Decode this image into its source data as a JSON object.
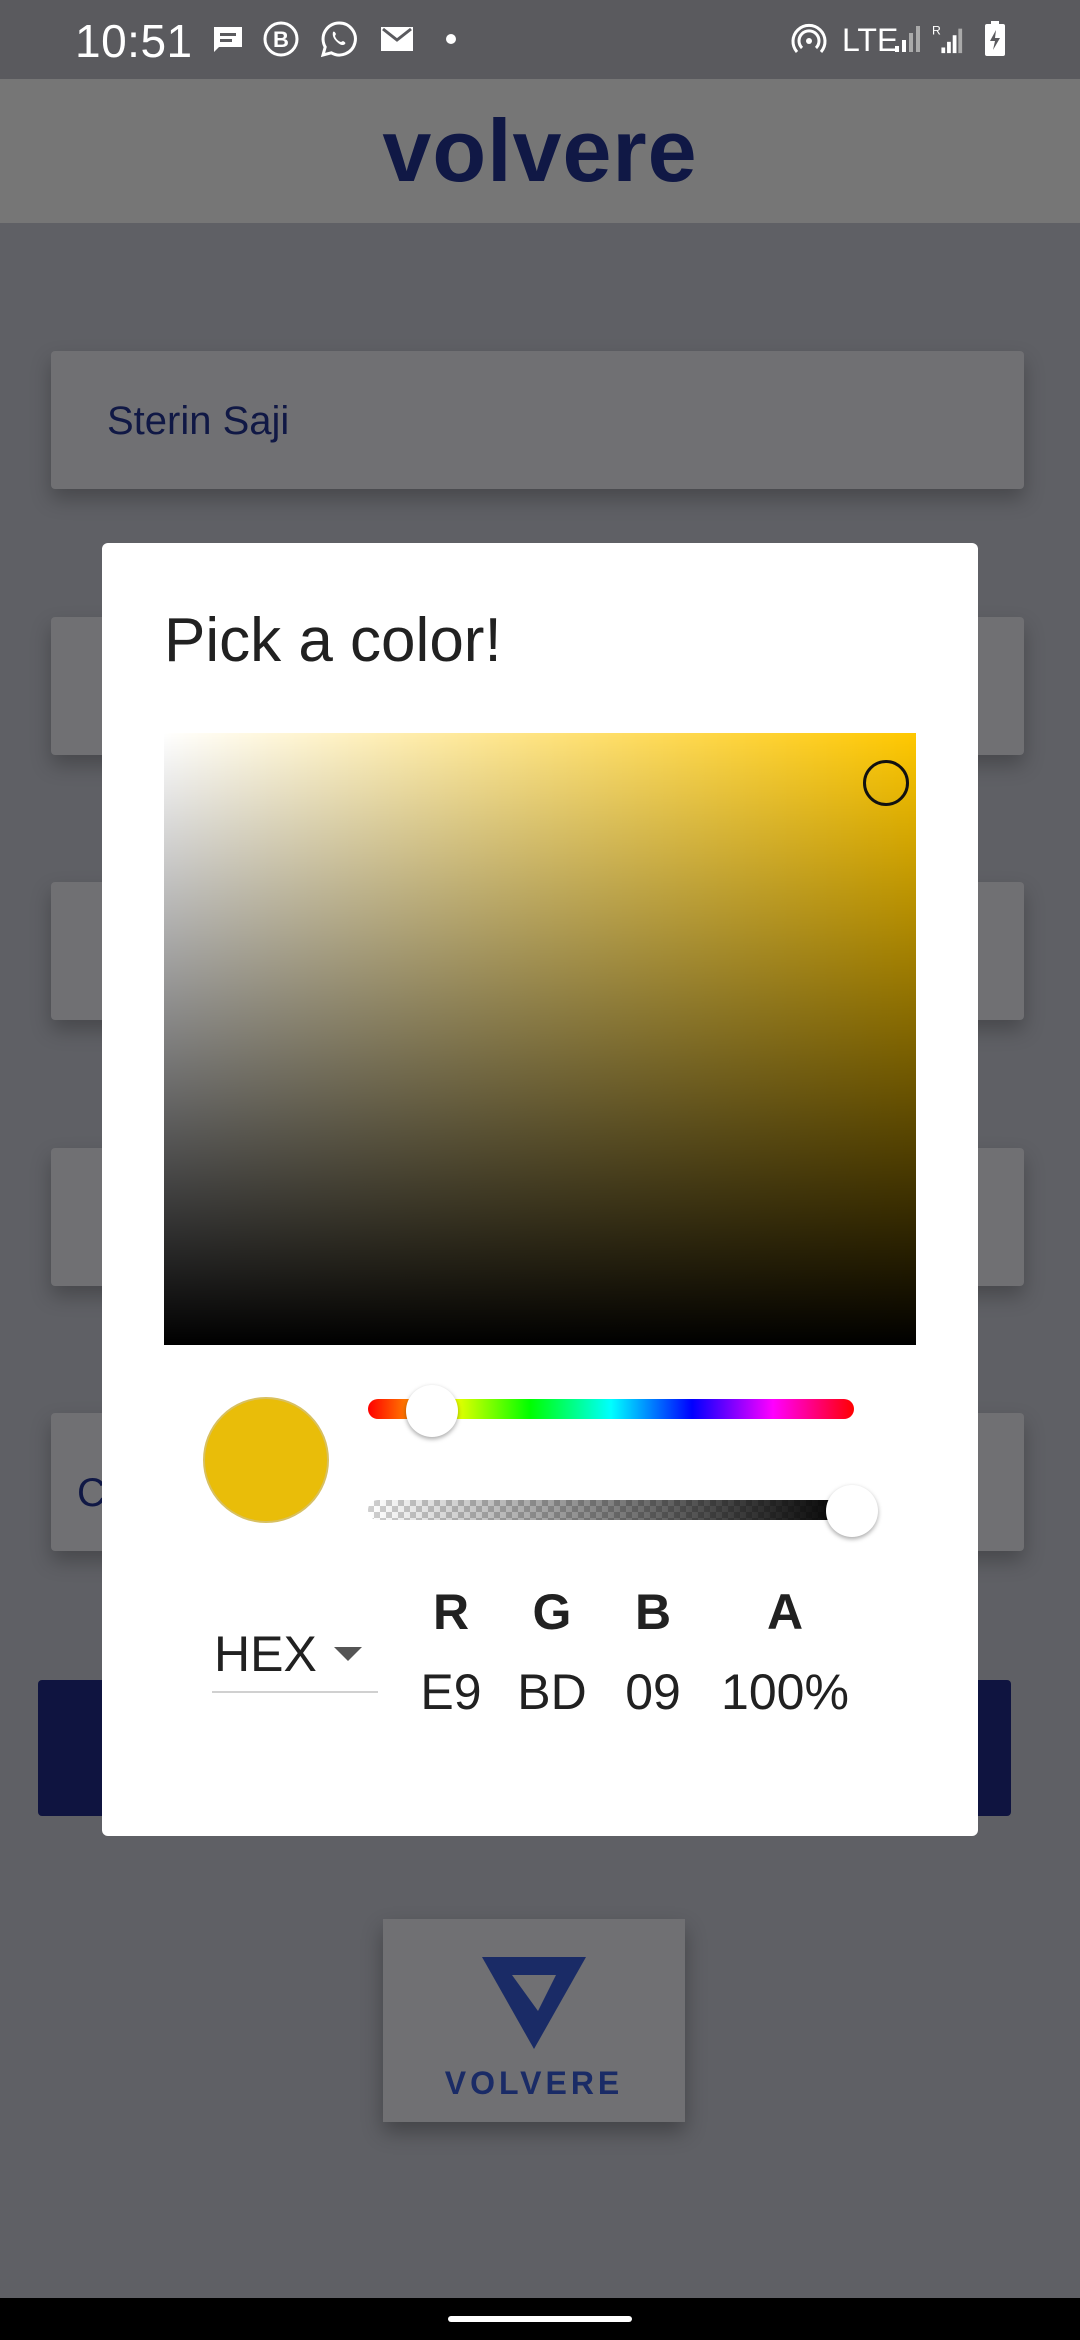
{
  "status_bar": {
    "time": "10:51",
    "network": "LTE",
    "roaming": "R",
    "icons": [
      "message-icon",
      "b-icon",
      "whatsapp-icon",
      "gmail-icon",
      "dot-icon",
      "hotspot-icon",
      "signal-icon",
      "signal-roaming-icon",
      "battery-charging-icon"
    ]
  },
  "app": {
    "title": "volvere",
    "title_color": "#101845",
    "form": {
      "name_value": "Sterin Saji",
      "partial_field_text": "C"
    },
    "logo_text": "VOLVERE"
  },
  "dialog": {
    "title": "Pick a color!",
    "hue_color": "#FFC800",
    "selected_color": "#E9BD09",
    "hue_fraction": 0.13,
    "alpha_fraction": 1.0,
    "format": "HEX",
    "channels": [
      {
        "label": "R",
        "value": "E9"
      },
      {
        "label": "G",
        "value": "BD"
      },
      {
        "label": "B",
        "value": "09"
      },
      {
        "label": "A",
        "value": "100%"
      }
    ]
  }
}
